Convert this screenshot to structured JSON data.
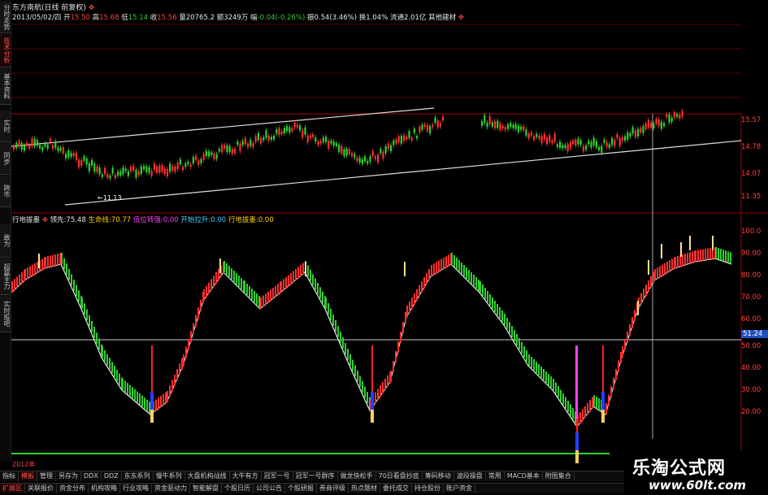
{
  "sidebar": {
    "tabs": [
      {
        "label": "分时走势",
        "active": false
      },
      {
        "label": "技术分析",
        "active": true
      },
      {
        "label": "基本资料",
        "active": false
      },
      {
        "label": "实时",
        "active": false
      },
      {
        "label": "同步",
        "active": false
      },
      {
        "label": "跨市",
        "active": false
      },
      {
        "label": "敢为",
        "active": false
      },
      {
        "label": "超赢主力",
        "active": false
      },
      {
        "label": "实时股吧",
        "active": false
      }
    ]
  },
  "header": {
    "title": "东方南航(日线 前复权)",
    "date": "2013/05/02/四",
    "open_label": "开",
    "open": "15.50",
    "high_label": "高",
    "high": "15.68",
    "low_label": "低",
    "low": "15.14",
    "close_label": "收",
    "close": "15.56",
    "vol_label": "量",
    "vol": "20765.2",
    "amt_label": "额",
    "amt": "3249万",
    "chg_label": "幅",
    "chg": "-0.04(-0.26%)",
    "amp_label": "振",
    "amp": "0.54(3.46%)",
    "turn_label": "换",
    "turn": "1.04%",
    "float_label": "流通",
    "float": "2.01亿",
    "extra": "其他建材"
  },
  "price_axis": [
    "15.57",
    "14.78",
    "14.07",
    "12.91",
    "11.35"
  ],
  "price_low_label": "←11.13",
  "indicator": {
    "name": "行地拔墨",
    "l1_label": "领先:",
    "l1": "75.48",
    "l2_label": "生命线:",
    "l2": "70.77",
    "l3_label": "低位转强:",
    "l3": "0.00",
    "l4_label": "开始拉升:",
    "l4": "0.00",
    "l5_label": "行地拔墨:",
    "l5": "0.00"
  },
  "ind_axis": [
    "100.0",
    "90.00",
    "80.00",
    "70.00",
    "60.00",
    "50.00",
    "40.00",
    "30.00",
    "20.00"
  ],
  "ind_current": "51.24",
  "date_axis": "2012年",
  "tabs_row1": [
    "指标",
    "模板",
    "管理",
    "另存为",
    "DDX",
    "DDZ",
    "东东系列",
    "慢牛系列",
    "大盘机构战线",
    "大牛有方",
    "冠军一号",
    "冠军一号群序",
    "做龙快松手",
    "70日看盘抄底",
    "筹码移动",
    "波段操盘",
    "常用",
    "MACD基本",
    "附图集合"
  ],
  "tabs_row2": [
    "扩展区",
    "关联报价",
    "资金分布",
    "机构攻略",
    "行业攻略",
    "资金驱动力",
    "智能解盘",
    "个股日历",
    "公司公告",
    "个股研报",
    "券商评级",
    "热点题材",
    "委托成交",
    "持仓股份",
    "账户资金"
  ],
  "watermark": {
    "site": "乐淘公式网",
    "url": "www.60lt.com"
  },
  "colors": {
    "up": "#ff3030",
    "down": "#30d030",
    "axis": "#ff4040",
    "bg": "#000000"
  }
}
